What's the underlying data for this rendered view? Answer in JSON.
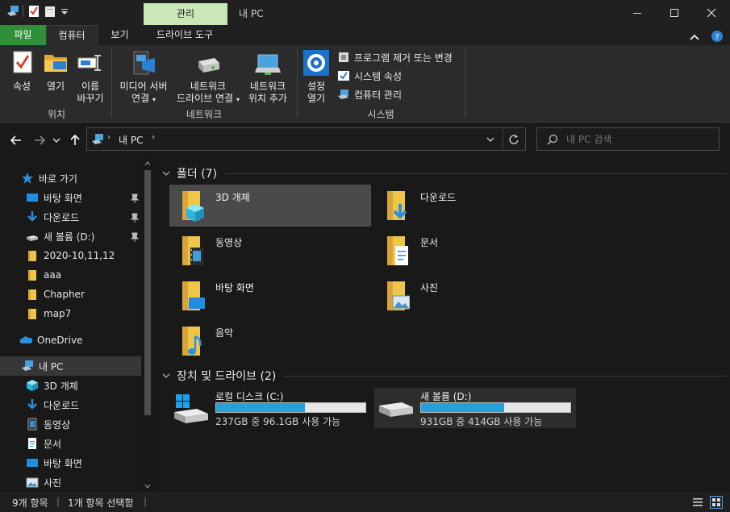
{
  "window": {
    "context_tab": "관리",
    "title": "내 PC"
  },
  "ribbon_tabs": [
    "파일",
    "컴퓨터",
    "보기",
    "드라이브 도구"
  ],
  "ribbon": {
    "location_group": {
      "label": "위치",
      "properties": "속성",
      "open": "열기",
      "rename_1": "이름",
      "rename_2": "바꾸기"
    },
    "network_group": {
      "label": "네트워크",
      "media_1": "미디어 서버",
      "media_2": "연결",
      "map_1": "네트워크",
      "map_2": "드라이브 연결",
      "add_1": "네트워크",
      "add_2": "위치 추가"
    },
    "system_group": {
      "label": "시스템",
      "settings_1": "설정",
      "settings_2": "열기",
      "uninstall": "프로그램 제거 또는 변경",
      "system_props": "시스템 속성",
      "manage": "컴퓨터 관리"
    }
  },
  "address": {
    "path": "내 PC",
    "search_placeholder": "내 PC 검색"
  },
  "nav": {
    "quick_access": "바로 가기",
    "quick_items": [
      "바탕 화면",
      "다운로드",
      "새 볼륨 (D:)",
      "2020-10,11,12",
      "aaa",
      "Chapher",
      "map7"
    ],
    "onedrive": "OneDrive",
    "this_pc": "내 PC",
    "pc_items": [
      "3D 개체",
      "다운로드",
      "동영상",
      "문서",
      "바탕 화면",
      "사진"
    ]
  },
  "content": {
    "folders_header": "폴더 (7)",
    "folders": [
      "3D 개체",
      "다운로드",
      "동영상",
      "문서",
      "바탕 화면",
      "사진",
      "음악"
    ],
    "drives_header": "장치 및 드라이브 (2)",
    "drives": [
      {
        "name": "로컬 디스크 (C:)",
        "info": "237GB 중 96.1GB 사용 가능",
        "used_fraction": 0.595
      },
      {
        "name": "새 볼륨 (D:)",
        "info": "931GB 중 414GB 사용 가능",
        "used_fraction": 0.555
      }
    ]
  },
  "status": {
    "count": "9개 항목",
    "selected": "1개 항목 선택함"
  },
  "colors": {
    "accent_green": "#2f8f3a",
    "context_tab": "#c9e8b7",
    "drive_bar": "#26a0da",
    "folder_yellow": "#f0c64a"
  }
}
